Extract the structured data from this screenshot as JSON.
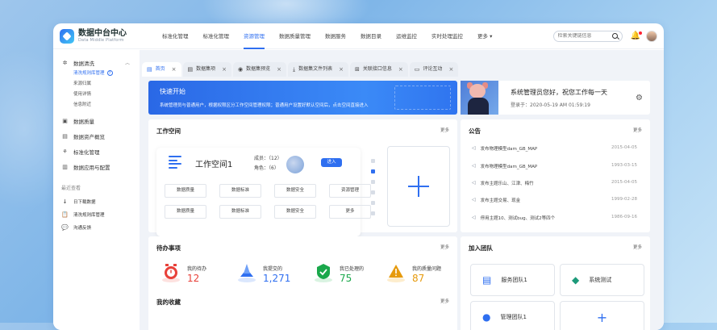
{
  "app": {
    "name": "数据中台中心",
    "subtitle": "Data Middle Platform"
  },
  "nav": [
    "标准化管理",
    "标准化管理",
    "资源管理",
    "数据质量管理",
    "数据服务",
    "数据目录",
    "运维监控",
    "实时处理监控",
    "更多"
  ],
  "nav_more_icon": "chevron-down",
  "search": {
    "placeholder": "检索关键链信息"
  },
  "sidebar": {
    "groups": [
      {
        "label": "数据清洗",
        "icon": "cleaning-icon",
        "subs": [
          "清洗规则库管理",
          "来源归属",
          "使用详情",
          "信息附近"
        ]
      },
      {
        "label": "数据质量",
        "icon": "quality-icon"
      },
      {
        "label": "数据资产概览",
        "icon": "asset-icon"
      },
      {
        "label": "标准化管理",
        "icon": "standard-icon"
      },
      {
        "label": "数据应用与配置",
        "icon": "config-icon"
      }
    ],
    "recent_title": "最近查看",
    "recent": [
      "日下载数据",
      "清洗规则库管理",
      "沟通反馈"
    ]
  },
  "tabs": [
    {
      "label": "首页",
      "active": true
    },
    {
      "label": "数据集项"
    },
    {
      "label": "数据集预览"
    },
    {
      "label": "数据集文件列表"
    },
    {
      "label": "关联接口信息"
    },
    {
      "label": "评论互动"
    }
  ],
  "banner": {
    "title": "快速开始",
    "desc": "系统管理员与普通用户，根据权限区分工作空间管理权限；普通用户设置好默认空间后，点击空间直接进入"
  },
  "user": {
    "greeting": "系统管理员您好，祝您工作每一天",
    "login": "登录于：2020-05-19  AM 01:59:19"
  },
  "workspace": {
    "title": "工作空间",
    "more": "更多",
    "name": "工作空间1",
    "members": "成员：（12）",
    "roles": "角色：（6）",
    "enter": "进入",
    "buttons": [
      "数据质量",
      "数据标准",
      "数据安全",
      "资源管理",
      "数据质量",
      "数据标准",
      "数据安全",
      "更多"
    ],
    "carousel_index": 1
  },
  "notice": {
    "title": "公告",
    "more": "更多",
    "items": [
      {
        "text": "发布物理模型dam_GB_MAP",
        "date": "2015-04-05"
      },
      {
        "text": "发布物理模型dam_GB_MAP",
        "date": "1993-03-15"
      },
      {
        "text": "发布主题乐山、江津、梅竹",
        "date": "2015-04-05"
      },
      {
        "text": "发布主题交易、现金",
        "date": "1999-02-28"
      },
      {
        "text": "停用主题10、测试bug、测试2等四个",
        "date": "1986-09-16"
      }
    ]
  },
  "todo": {
    "title": "待办事项",
    "more": "更多",
    "items": [
      {
        "label": "我的待办",
        "value": "12",
        "color": "#e8413a"
      },
      {
        "label": "我提交的",
        "value": "1,271",
        "color": "#2f6ff0"
      },
      {
        "label": "我已处理的",
        "value": "75",
        "color": "#1aa84b"
      },
      {
        "label": "我的质量问题",
        "value": "87",
        "color": "#e69a0c"
      }
    ]
  },
  "favorites": {
    "title": "我的收藏",
    "more": "更多"
  },
  "teams": {
    "title": "加入团队",
    "more": "更多",
    "items": [
      "服务团队1",
      "系统测试",
      "管理团队1"
    ]
  }
}
